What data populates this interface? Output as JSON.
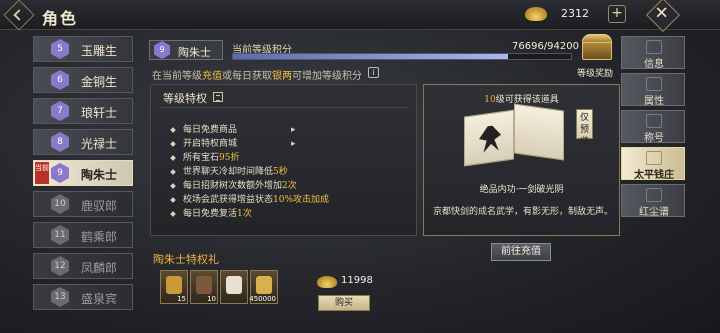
{
  "header": {
    "title": "角色",
    "currency_value": "2312"
  },
  "ranks": [
    {
      "level": "5",
      "name": "玉雕生",
      "state": "normal"
    },
    {
      "level": "6",
      "name": "金铜生",
      "state": "normal"
    },
    {
      "level": "7",
      "name": "琅轩士",
      "state": "normal"
    },
    {
      "level": "8",
      "name": "光禄士",
      "state": "normal"
    },
    {
      "level": "9",
      "name": "陶朱士",
      "state": "active"
    },
    {
      "level": "10",
      "name": "鹿驭郎",
      "state": "locked"
    },
    {
      "level": "11",
      "name": "鹤乘郎",
      "state": "locked"
    },
    {
      "level": "12",
      "name": "凤麟郎",
      "state": "locked"
    },
    {
      "level": "13",
      "name": "盛泉宾",
      "state": "locked"
    }
  ],
  "current_tag": "当前",
  "current_rank": {
    "level": "9",
    "name": "陶朱士"
  },
  "exp": {
    "label": "当前等级积分",
    "value_text": "76696/94200",
    "current": 76696,
    "max": 94200
  },
  "hint": {
    "prefix": "在当前等级",
    "hl1": "充值",
    "mid": "或每日获取",
    "hl2": "银两",
    "suffix": "可增加等级积分"
  },
  "reward_chest_label": "等级奖励",
  "privileges": {
    "title": "等级特权",
    "items": [
      {
        "text": "每日免费商品",
        "hl": "",
        "after": "",
        "has_arrow": true
      },
      {
        "text": "开启特权商城",
        "hl": "",
        "after": "",
        "has_arrow": true
      },
      {
        "text": "所有宝石",
        "hl": "95折",
        "after": "",
        "has_arrow": false
      },
      {
        "text": "世界聊天冷却时间降低",
        "hl": "5秒",
        "after": "",
        "has_arrow": false
      },
      {
        "text": "每日招财树次数额外增加",
        "hl": "2次",
        "after": "",
        "has_arrow": false
      },
      {
        "text": "校场会武获得增益状态",
        "hl": "10%攻击加成",
        "after": "",
        "has_arrow": false
      },
      {
        "text": "每日免费复活",
        "hl": "1次",
        "after": "",
        "has_arrow": false
      }
    ]
  },
  "item_card": {
    "header_lv": "10",
    "header_rest": "级可获得该道具",
    "preview_label": "仅预览",
    "name": "绝品内功·一剑破光阴",
    "description": "京都快剑的成名武学，有影无形，制敌无声。"
  },
  "goto_button": "前往充值",
  "gift": {
    "title": "陶朱士特权礼",
    "slots": [
      {
        "count": "15",
        "color": "#c89a3a"
      },
      {
        "count": "10",
        "color": "#7a5a3a"
      },
      {
        "count": "",
        "color": "#e8e0d0"
      },
      {
        "count": "450000",
        "color": "#d8b050"
      }
    ],
    "price": "11998",
    "buy_label": "购买"
  },
  "right_tabs": [
    {
      "label": "信息",
      "active": false
    },
    {
      "label": "属性",
      "active": false
    },
    {
      "label": "称号",
      "active": false
    },
    {
      "label": "太平钱庄",
      "active": true
    },
    {
      "label": "红尘谱",
      "active": false
    }
  ],
  "colors": {
    "accent_gold": "#f0c040",
    "exp_fill": "#aab6f0",
    "rank_badge": "#8a78c8"
  }
}
